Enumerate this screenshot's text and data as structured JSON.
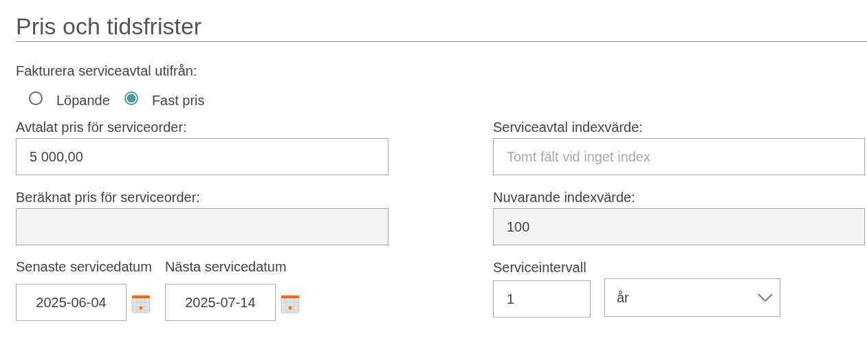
{
  "title": "Pris och tidsfrister",
  "billing": {
    "label": "Fakturera serviceavtal utifrån:",
    "options": [
      {
        "label": "Löpande",
        "selected": false
      },
      {
        "label": "Fast pris",
        "selected": true
      }
    ]
  },
  "left_fields": [
    {
      "label": "Avtalat pris för serviceorder:",
      "value": "5 000,00",
      "disabled": false
    },
    {
      "label": "Beräknat pris för serviceorder:",
      "disabled": true
    }
  ],
  "dates": [
    {
      "label": "Senaste servicedatum",
      "value": "2025-06-04"
    },
    {
      "label": "Nästa servicedatum",
      "value": "2025-07-14"
    }
  ],
  "right_fields": [
    {
      "label": "Serviceavtal indexvärde:",
      "placeholder": "Tomt fält vid inget index",
      "disabled": false
    },
    {
      "label": "Nuvarande indexvärde:",
      "value": "100",
      "disabled": true
    }
  ],
  "interval": {
    "label": "Serviceintervall",
    "value": "1",
    "unit": "år"
  }
}
